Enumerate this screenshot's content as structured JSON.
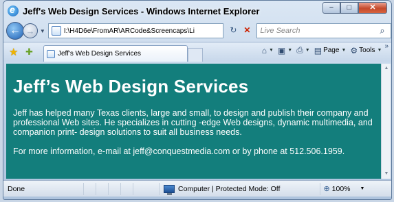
{
  "window": {
    "title": "Jeff's Web Design Services - Windows Internet Explorer"
  },
  "address_bar": {
    "url": "I:\\H4D6e\\FromAR\\ARCode&Screencaps\\Li"
  },
  "search": {
    "placeholder": "Live Search"
  },
  "tab": {
    "label": "Jeff's Web Design Services"
  },
  "command_bar": {
    "page_label": "Page",
    "tools_label": "Tools"
  },
  "page": {
    "heading": "Jeff’s Web Design Services",
    "paragraph1": "Jeff has helped many Texas clients, large and small, to design and publish their company and professional Web sites. He specializes in cutting -edge Web designs, dynamic multimedia, and companion print- design solutions to suit all business needs.",
    "paragraph2": "For more information, e-mail at jeff@conquestmedia.com or by phone at 512.506.1959."
  },
  "status_bar": {
    "status": "Done",
    "zone": "Computer | Protected Mode: Off",
    "zoom": "100%"
  },
  "colors": {
    "content_bg": "#137e7c",
    "content_text": "#ffffff"
  }
}
